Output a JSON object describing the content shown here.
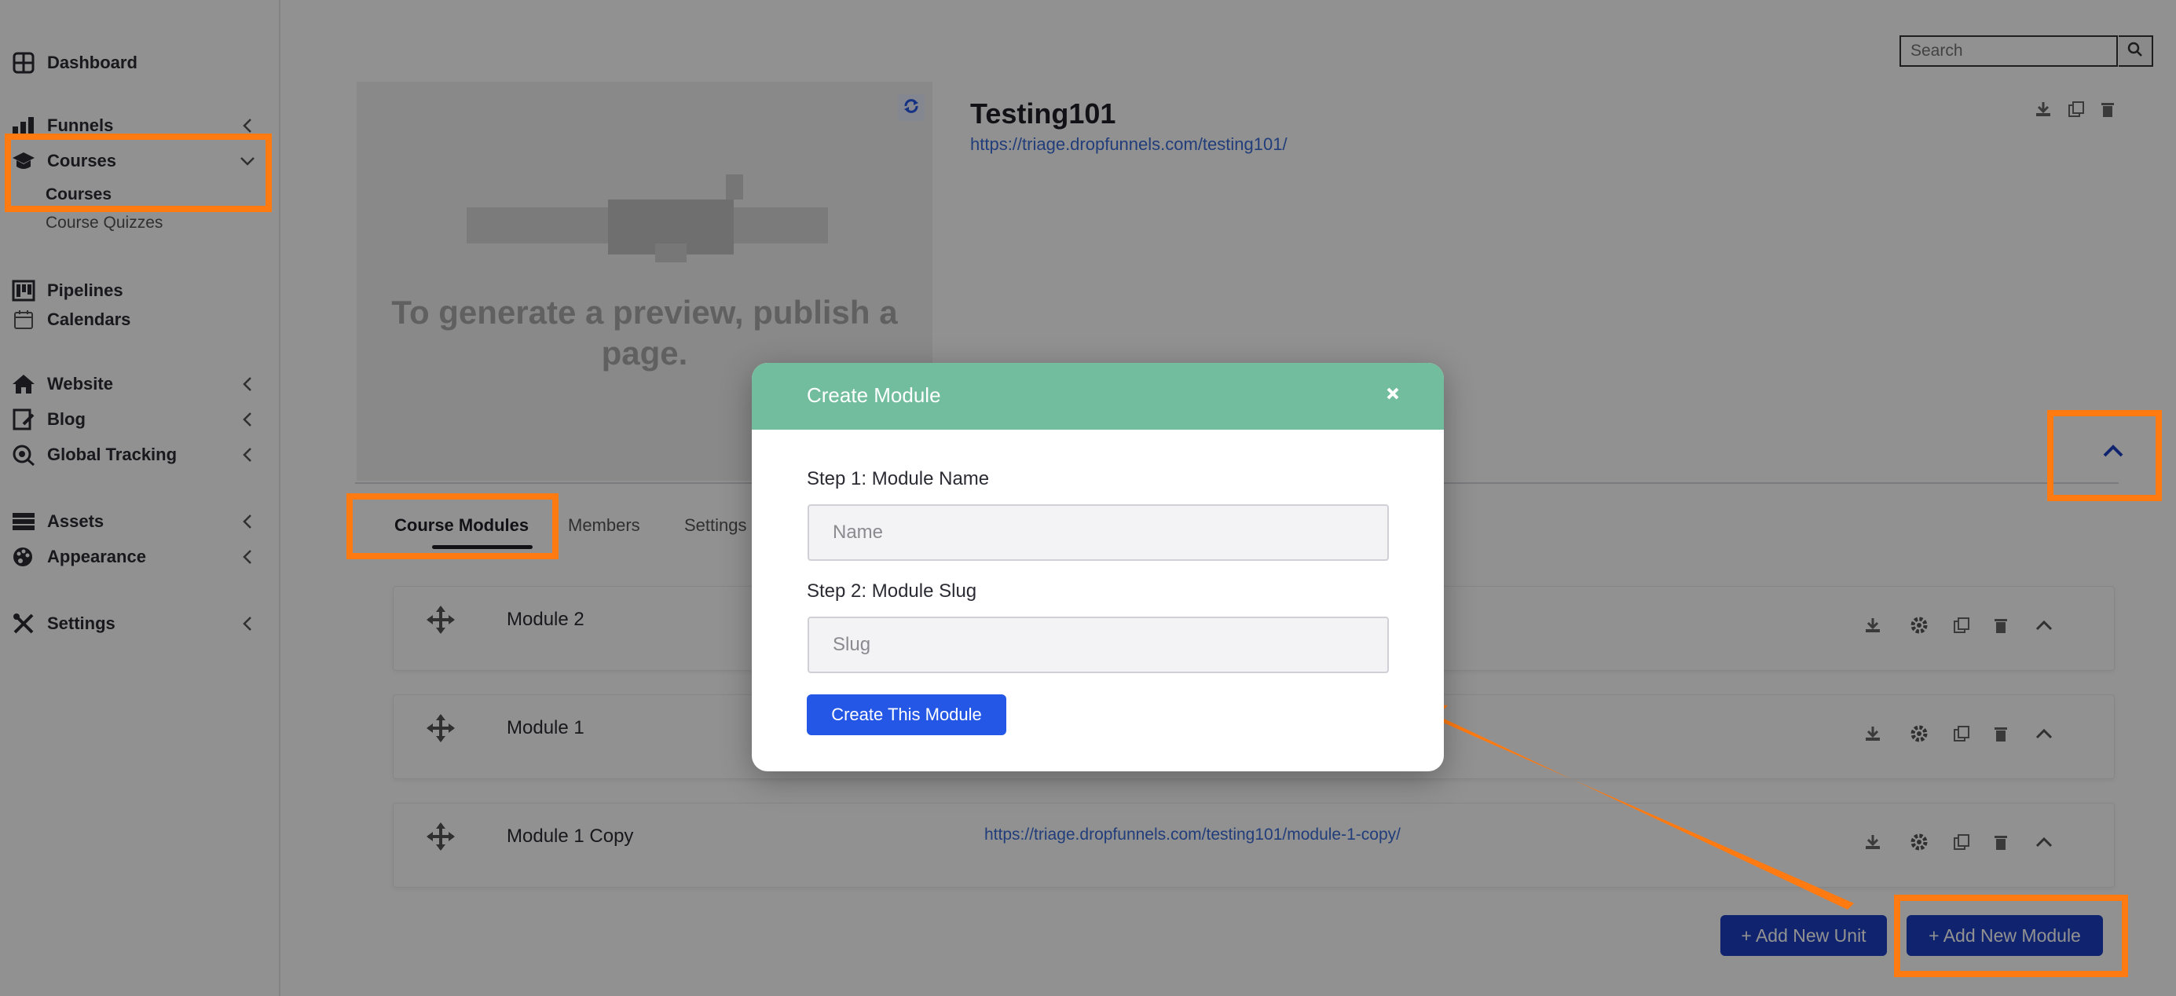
{
  "sidebar": {
    "items": [
      {
        "label": "Dashboard",
        "icon": "dashboard-icon"
      },
      {
        "label": "Funnels",
        "icon": "funnel-icon"
      },
      {
        "label": "Courses",
        "icon": "graduation-cap-icon"
      },
      {
        "label": "Pipelines",
        "icon": "pipeline-icon"
      },
      {
        "label": "Calendars",
        "icon": "calendar-icon"
      },
      {
        "label": "Website",
        "icon": "home-icon"
      },
      {
        "label": "Blog",
        "icon": "blog-icon"
      },
      {
        "label": "Global Tracking",
        "icon": "tracking-icon"
      },
      {
        "label": "Assets",
        "icon": "assets-icon"
      },
      {
        "label": "Appearance",
        "icon": "palette-icon"
      },
      {
        "label": "Settings",
        "icon": "tools-icon"
      }
    ],
    "courses_sub": [
      "Courses",
      "Course Quizzes"
    ]
  },
  "search": {
    "placeholder": "Search"
  },
  "course": {
    "title": "Testing101",
    "url": "https://triage.dropfunnels.com/testing101/",
    "preview_text": "To generate a preview, publish a page."
  },
  "tabs": [
    "Course Modules",
    "Members",
    "Settings"
  ],
  "modules": [
    {
      "name": "Module 2",
      "url": ""
    },
    {
      "name": "Module 1",
      "url": ""
    },
    {
      "name": "Module 1 Copy",
      "url": "https://triage.dropfunnels.com/testing101/module-1-copy/"
    }
  ],
  "buttons": {
    "add_unit": "+ Add New Unit",
    "add_module": "+ Add New Module"
  },
  "modal": {
    "title": "Create Module",
    "step1_label": "Step 1: Module Name",
    "step1_placeholder": "Name",
    "step2_label": "Step 2: Module Slug",
    "step2_placeholder": "Slug",
    "submit_label": "Create This Module"
  },
  "colors": {
    "highlight": "#ff7a10",
    "modal_header": "#71bd9d",
    "primary_button": "#2457e6",
    "action_button": "#1d3fc3",
    "link": "#3b6bd6"
  }
}
